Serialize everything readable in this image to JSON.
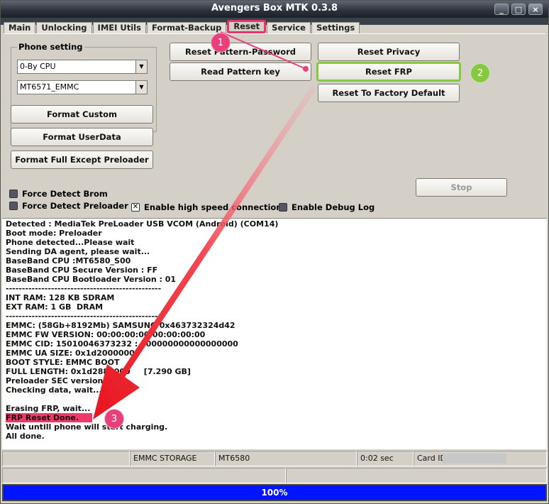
{
  "window": {
    "title": "Avengers Box MTK 0.3.8",
    "min": "_",
    "max": "□",
    "close": "×"
  },
  "tabs": [
    {
      "label": "Main"
    },
    {
      "label": "Unlocking"
    },
    {
      "label": "IMEI Utils"
    },
    {
      "label": "Format-Backup"
    },
    {
      "label": "Reset",
      "active": true
    },
    {
      "label": "Service"
    },
    {
      "label": "Settings"
    }
  ],
  "phone_setting": {
    "title": "Phone setting",
    "cpu_select": "0-By CPU",
    "model_select": "MT6571_EMMC"
  },
  "buttons": {
    "format_custom": "Format Custom",
    "format_userdata": "Format UserData",
    "format_full": "Format Full Except Preloader",
    "reset_pattern": "Reset Pattern-Password",
    "read_pattern": "Read Pattern key",
    "reset_privacy": "Reset Privacy",
    "reset_frp": "Reset FRP",
    "reset_factory": "Reset To Factory Default",
    "stop": "Stop"
  },
  "options": {
    "force_brom": "Force Detect Brom",
    "force_preloader": "Force Detect Preloader",
    "high_speed": "Enable high speed connection",
    "debug_log": "Enable Debug Log"
  },
  "log_lines": [
    "Detected : MediaTek PreLoader USB VCOM (Android) (COM14)",
    "Boot mode: Preloader",
    "Phone detected...Please wait",
    "Sending DA agent, please wait...",
    "BaseBand CPU :MT6580_S00",
    "BaseBand CPU Secure Version : FF",
    "BaseBand CPU Bootloader Version : 01",
    "------------------------------------------------",
    "INT RAM: 128 KB SDRAM",
    "EXT RAM: 1 GB  DRAM",
    "------------------------------------------------",
    "EMMC: (58Gb+8192Mb) SAMSUNG 0x463732324d42",
    "EMMC FW VERSION: 00:00:00:00:00:00:00:00",
    "EMMC CID: 15010046373232 : 000000000000000000",
    "EMMC UA SIZE: 0x1d2000000",
    "BOOT STYLE: EMMC BOOT",
    "FULL LENGTH: 0x1d2880000     [7.290 GB]",
    "Preloader SEC version: 2",
    "Checking data, wait...",
    "",
    "Erasing FRP, wait...",
    "FRP Reset Done.",
    "Wait untill phone will start charging.",
    "All done."
  ],
  "status": {
    "storage": "EMMC STORAGE",
    "chip": "MT6580",
    "time": "0:02 sec",
    "card_id": "Card ID"
  },
  "progress": {
    "text": "100%",
    "value": 100
  },
  "steps": {
    "one": "1",
    "two": "2",
    "three": "3"
  },
  "colors": {
    "highlight_pink": "#e8336b",
    "highlight_green": "#86c843",
    "progress": "#0014ff"
  }
}
